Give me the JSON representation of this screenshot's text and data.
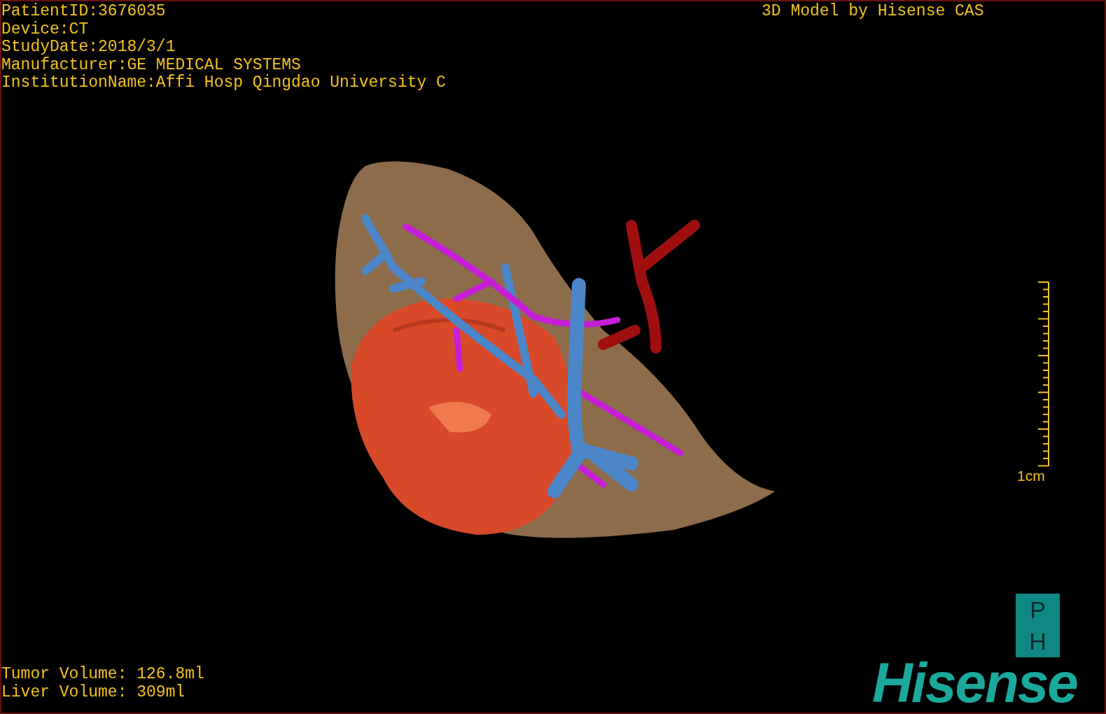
{
  "patient_info": [
    "PatientID:3676035",
    "Device:CT",
    "StudyDate:2018/3/1",
    "Manufacturer:GE MEDICAL SYSTEMS",
    "InstitutionName:Affi Hosp Qingdao University C"
  ],
  "title": "3D Model by Hisense CAS",
  "scale_bar": {
    "label": "1cm"
  },
  "volumes": [
    "Tumor Volume: 126.8ml",
    "Liver Volume: 309ml"
  ],
  "logo": {
    "badge_letters": [
      "P",
      "H"
    ],
    "brand": "Hisense"
  }
}
